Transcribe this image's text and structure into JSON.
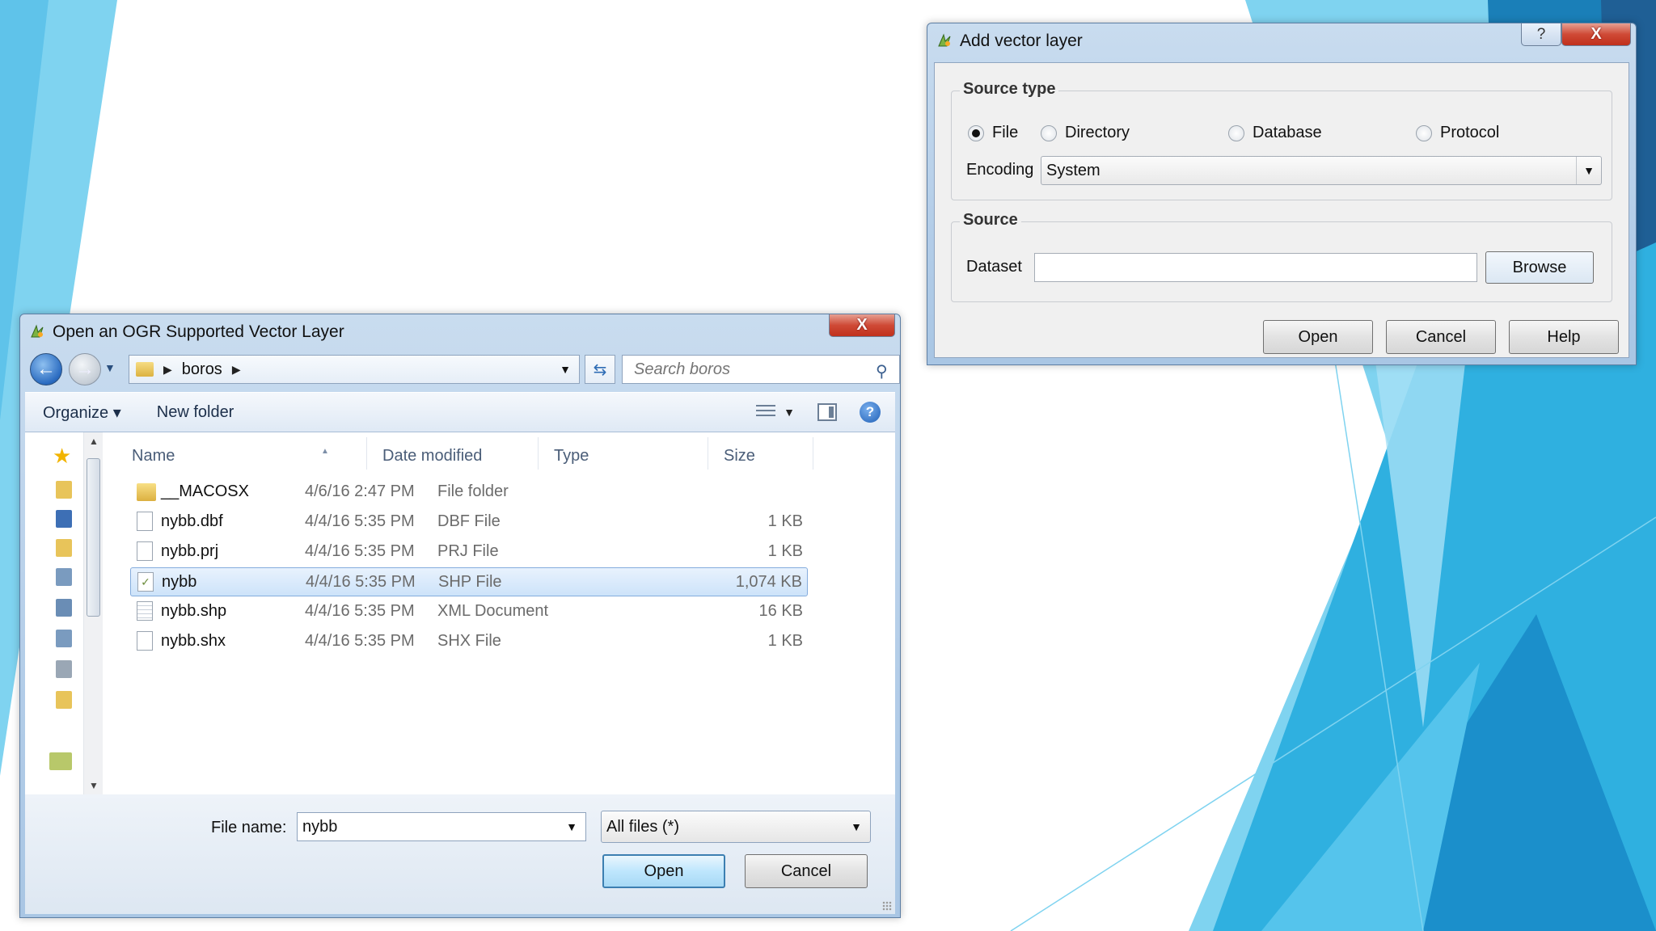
{
  "colors": {
    "bg_light": "#7fd3f0",
    "bg_mid": "#2fb0e0",
    "bg_dark": "#1a7fb8",
    "bg_navy": "#1f5f95",
    "selection": "#cde3fa",
    "default_button_border": "#3c7fb1",
    "close_button": "#c0301c"
  },
  "open_dialog": {
    "title": "Open an OGR Supported Vector Layer",
    "title_icon": "qgis-icon",
    "close_glyph": "X",
    "address": {
      "folder": "boros"
    },
    "search_placeholder": "Search boros",
    "toolbar": {
      "organize": "Organize ▾",
      "new_folder": "New folder"
    },
    "columns": {
      "name": "Name",
      "date": "Date modified",
      "type": "Type",
      "size": "Size"
    },
    "files": [
      {
        "name": "__MACOSX",
        "date": "4/6/16 2:47 PM",
        "type": "File folder",
        "size": "",
        "icon": "folder-icon"
      },
      {
        "name": "nybb.dbf",
        "date": "4/4/16 5:35 PM",
        "type": "DBF File",
        "size": "1 KB",
        "icon": "file-icon"
      },
      {
        "name": "nybb.prj",
        "date": "4/4/16 5:35 PM",
        "type": "PRJ File",
        "size": "1 KB",
        "icon": "file-icon"
      },
      {
        "name": "nybb",
        "date": "4/4/16 5:35 PM",
        "type": "SHP File",
        "size": "1,074 KB",
        "icon": "shp-file-icon",
        "selected": true
      },
      {
        "name": "nybb.shp",
        "date": "4/4/16 5:35 PM",
        "type": "XML Document",
        "size": "16 KB",
        "icon": "xml-file-icon"
      },
      {
        "name": "nybb.shx",
        "date": "4/4/16 5:35 PM",
        "type": "SHX File",
        "size": "1 KB",
        "icon": "file-icon"
      }
    ],
    "file_name_label": "File name:",
    "file_name_value": "nybb",
    "filter_value": "All files (*)",
    "open_label": "Open",
    "cancel_label": "Cancel"
  },
  "vector_dialog": {
    "title": "Add vector layer",
    "title_icon": "qgis-icon",
    "help_glyph": "?",
    "close_glyph": "X",
    "source_type_title": "Source type",
    "radios": {
      "file": "File",
      "directory": "Directory",
      "database": "Database",
      "protocol": "Protocol"
    },
    "selected_radio": "File",
    "encoding_label": "Encoding",
    "encoding_value": "System",
    "source_title": "Source",
    "dataset_label": "Dataset",
    "dataset_value": "",
    "browse_label": "Browse",
    "open_label": "Open",
    "cancel_label": "Cancel",
    "help_label": "Help"
  }
}
